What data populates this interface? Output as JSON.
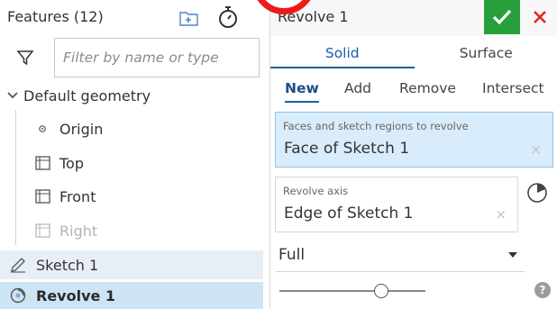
{
  "features_panel": {
    "header": "Features (12)",
    "filter_placeholder": "Filter by name or type",
    "group": {
      "label": "Default geometry",
      "expanded": true
    },
    "tree_items": [
      {
        "label": "Origin",
        "icon": "origin-point-icon",
        "faded": false
      },
      {
        "label": "Top",
        "icon": "plane-icon",
        "faded": false
      },
      {
        "label": "Front",
        "icon": "plane-icon",
        "faded": false
      },
      {
        "label": "Right",
        "icon": "plane-icon",
        "faded": true
      }
    ],
    "features": [
      {
        "label": "Sketch 1",
        "icon": "sketch-pencil-icon"
      },
      {
        "label": "Revolve 1",
        "icon": "revolve-icon",
        "selected": true
      }
    ]
  },
  "dialog": {
    "title": "Revolve 1",
    "type_tabs": [
      {
        "label": "Solid",
        "active": true
      },
      {
        "label": "Surface",
        "active": false
      }
    ],
    "op_tabs": [
      {
        "label": "New",
        "active": true
      },
      {
        "label": "Add",
        "active": false
      },
      {
        "label": "Remove",
        "active": false
      },
      {
        "label": "Intersect",
        "active": false
      }
    ],
    "faces_field": {
      "label": "Faces and sketch regions to revolve",
      "value": "Face of Sketch 1"
    },
    "axis_field": {
      "label": "Revolve axis",
      "value": "Edge of Sketch 1"
    },
    "revolve_type": "Full",
    "slider_value": 0.7
  },
  "colors": {
    "accent_blue": "#1a5fa8",
    "ok_green": "#27a03c",
    "cancel_red": "#e0281e",
    "selected_row": "#cde4f5",
    "active_field": "#d9ecfb",
    "annotation_ring": "#ee1a1a"
  }
}
